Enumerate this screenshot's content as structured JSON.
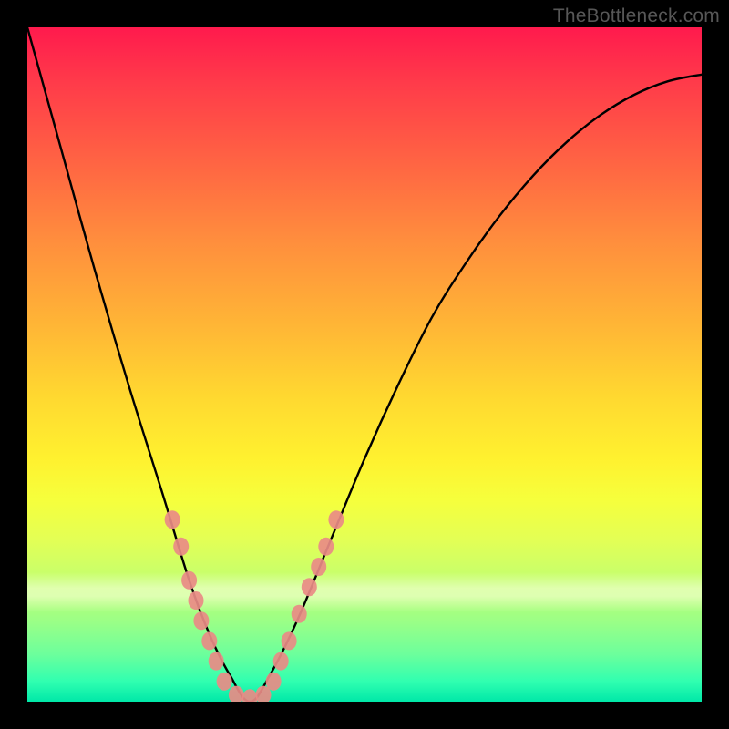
{
  "watermark": "TheBottleneck.com",
  "chart_data": {
    "type": "line",
    "title": "",
    "xlabel": "",
    "ylabel": "",
    "xlim": [
      0,
      100
    ],
    "ylim": [
      0,
      100
    ],
    "series": [
      {
        "name": "bottleneck-curve",
        "x": [
          0,
          5,
          10,
          15,
          20,
          24,
          27,
          30,
          33,
          36,
          40,
          45,
          50,
          55,
          60,
          65,
          70,
          75,
          80,
          85,
          90,
          95,
          100
        ],
        "y": [
          100,
          82,
          64,
          47,
          31,
          18,
          10,
          4,
          0,
          4,
          12,
          24,
          36,
          47,
          57,
          65,
          72,
          78,
          83,
          87,
          90,
          92,
          93
        ]
      }
    ],
    "markers": {
      "name": "highlight-dots",
      "color": "#e98b86",
      "points": [
        {
          "x": 21.5,
          "y": 27
        },
        {
          "x": 22.8,
          "y": 23
        },
        {
          "x": 24.0,
          "y": 18
        },
        {
          "x": 25.0,
          "y": 15
        },
        {
          "x": 25.8,
          "y": 12
        },
        {
          "x": 27.0,
          "y": 9
        },
        {
          "x": 28.0,
          "y": 6
        },
        {
          "x": 29.2,
          "y": 3
        },
        {
          "x": 31.0,
          "y": 1
        },
        {
          "x": 33.0,
          "y": 0.5
        },
        {
          "x": 35.0,
          "y": 1
        },
        {
          "x": 36.5,
          "y": 3
        },
        {
          "x": 37.6,
          "y": 6
        },
        {
          "x": 38.8,
          "y": 9
        },
        {
          "x": 40.3,
          "y": 13
        },
        {
          "x": 41.8,
          "y": 17
        },
        {
          "x": 43.2,
          "y": 20
        },
        {
          "x": 44.3,
          "y": 23
        },
        {
          "x": 45.8,
          "y": 27
        }
      ]
    },
    "background_gradient": {
      "top": "#ff1a4d",
      "mid": "#fff12f",
      "bottom": "#00e8a8"
    }
  }
}
